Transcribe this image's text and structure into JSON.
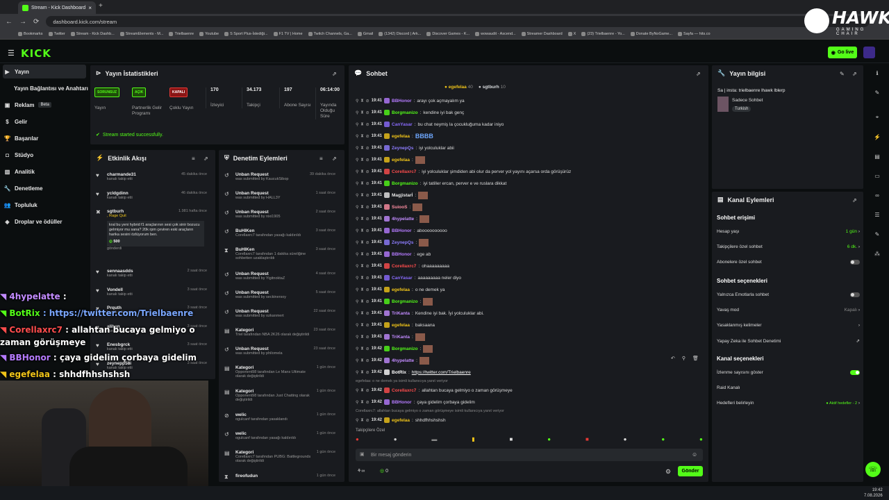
{
  "browser": {
    "tab_title": "Stream - Kick Dashboard",
    "url": "dashboard.kick.com/stream",
    "bookmarks": [
      "Bookmarks",
      "Twitter",
      "Stream - Kick Dashb...",
      "StreamElements - M...",
      "Trielbaenre",
      "Youtube",
      "S Sport Plus-İstediği...",
      "F1 TV | Home",
      "Twitch Channels, Ga...",
      "Gmail",
      "(1342) Discord | Ark...",
      "Discover Games - K...",
      "wowaudit - Ascend...",
      "Streamer Dashboard",
      "X",
      "(23) Trielbaenre - Yo...",
      "Donate ByNoGame...",
      "Sayfa — hits.co"
    ]
  },
  "brand": {
    "logo": "KICK",
    "go_live": "Go live",
    "hawk": "HAWK",
    "hawk_sub": "GAMING CHAIR"
  },
  "sidebar": [
    {
      "label": "Yayın",
      "icon": "video-icon"
    },
    {
      "label": "Yayın Bağlantısı ve Anahtarı",
      "icon": ""
    },
    {
      "label": "Reklam",
      "icon": "ad-icon",
      "badge": "Beta"
    },
    {
      "label": "Gelir",
      "icon": "money-icon"
    },
    {
      "label": "Başarılar",
      "icon": "trophy-icon"
    },
    {
      "label": "Stüdyo",
      "icon": "studio-icon"
    },
    {
      "label": "Analitik",
      "icon": "chart-icon"
    },
    {
      "label": "Denetleme",
      "icon": "wrench-icon"
    },
    {
      "label": "Topluluk",
      "icon": "community-icon"
    },
    {
      "label": "Droplar ve ödüller",
      "icon": "drop-icon"
    }
  ],
  "stats": {
    "title": "Yayın İstatistikleri",
    "items": [
      {
        "badge": "SORUNSUZ",
        "badge_color": "#53fc18",
        "label": "Yayın"
      },
      {
        "badge": "AÇIK",
        "badge_color": "#53fc18",
        "label": "Partnerlik Gelir Programı"
      },
      {
        "badge": "KAPALI",
        "badge_color": "#e53935",
        "label": "Çoklu Yayın"
      },
      {
        "value": "170",
        "label": "İzleyici"
      },
      {
        "value": "34.173",
        "label": "Takipçi"
      },
      {
        "value": "197",
        "label": "Abone Sayısı"
      },
      {
        "value": "06:14:00",
        "label": "Yayında Olduğu Süre"
      }
    ],
    "success": "Stream started successfully."
  },
  "activity": {
    "title": "Etkinlik Akışı",
    "items": [
      {
        "name": "charmande31",
        "desc": "kanalı takip etti",
        "time": "45 dakika önce",
        "icon": "heart-icon"
      },
      {
        "name": "ycldgdinn",
        "desc": "kanalı takip etti",
        "time": "46 dakika önce",
        "icon": "heart-icon"
      },
      {
        "name": "sgtburh",
        "desc": ", Rage Quit",
        "time": "1.981 hafta önce",
        "icon": "x-icon",
        "note": "kral bu yeni hybrid f1 araçlarının sesi çok sinir bozucu gelmiyor mu sana? 20k rpm çeviren eski araçların harika sesini özlüyorum ben.",
        "amount": "500",
        "sent": "gönderdi"
      },
      {
        "name": "sennaasdds",
        "desc": "kanalı takip etti",
        "time": "2 saat önce",
        "icon": "heart-icon"
      },
      {
        "name": "Vondell",
        "desc": "kanalı takip etti",
        "time": "3 saat önce",
        "icon": "heart-icon"
      },
      {
        "name": "Prquth",
        "desc": "kanalı takip etti",
        "time": "3 saat önce",
        "icon": "heart-icon"
      },
      {
        "name": "alihan",
        "desc": "kanalı takip etti",
        "time": "3 saat önce",
        "icon": "heart-icon"
      },
      {
        "name": "Enesbgrck",
        "desc": "kanalı takip etti",
        "time": "3 saat önce",
        "icon": "heart-icon"
      },
      {
        "name": "zeynepp58i",
        "desc": "kanalı takip etti",
        "time": "3 saat önce",
        "icon": "heart-icon"
      }
    ]
  },
  "moderation": {
    "title": "Denetim Eylemleri",
    "items": [
      {
        "title": "Unban Request",
        "desc": "was submitted by KaucukSibop",
        "time": "39 dakika önce",
        "icon": "undo-icon"
      },
      {
        "title": "Unban Request",
        "desc": "was submitted by HALL3Y",
        "time": "1 saat önce",
        "icon": "undo-icon"
      },
      {
        "title": "Unban Request",
        "desc": "was submitted by nixi1905",
        "time": "2 saat önce",
        "icon": "undo-icon"
      },
      {
        "title": "BuHIKen",
        "desc": "Corellaxrc7 tarafından yasağı kaldırıldı",
        "time": "3 saat önce",
        "icon": "undo-icon"
      },
      {
        "title": "BuHIKen",
        "desc": "Corellaxrc7 tarafından 1 dakika süreliğine sohbetten uzaklaştırıldı",
        "time": "3 saat önce",
        "icon": "hourglass-icon"
      },
      {
        "title": "Unban Request",
        "desc": "was submitted by YigitnoktaZ",
        "time": "4 saat önce",
        "icon": "undo-icon"
      },
      {
        "title": "Unban Request",
        "desc": "was submitted by seckinersoy",
        "time": "5 saat önce",
        "icon": "undo-icon"
      },
      {
        "title": "Unban Request",
        "desc": "was submitted by ozkanmert",
        "time": "22 saat önce",
        "icon": "undo-icon"
      },
      {
        "title": "Kategori",
        "desc": "Triel tarafından NBA 2K26 olarak değiştirildi",
        "time": "23 saat önce",
        "icon": "category-icon"
      },
      {
        "title": "Unban Request",
        "desc": "was submitted by philomela",
        "time": "23 saat önce",
        "icon": "undo-icon"
      },
      {
        "title": "Kategori",
        "desc": "Opponent98 tarafından Le Mans Ultimate olarak değiştirildi",
        "time": "1 gün önce",
        "icon": "category-icon"
      },
      {
        "title": "Kategori",
        "desc": "Opponent98 tarafından Just Chatting olarak değiştirildi",
        "time": "1 gün önce",
        "icon": "category-icon"
      },
      {
        "title": "welic",
        "desc": "ogulcanf tarafından yasaklandı",
        "time": "1 gün önce",
        "icon": "ban-icon"
      },
      {
        "title": "welic",
        "desc": "ogulcanf tarafından yasağı kaldırıldı",
        "time": "1 gün önce",
        "icon": "undo-icon"
      },
      {
        "title": "Kategori",
        "desc": "Corellaxrc7 tarafından PUBG: Battlegrounds olarak değiştirildi",
        "time": "1 gün önce",
        "icon": "category-icon"
      },
      {
        "title": "fireofudun",
        "desc": "",
        "time": "1 gün önce",
        "icon": "hourglass-icon"
      }
    ]
  },
  "chat": {
    "title": "Sohbet",
    "pinned": [
      {
        "name": "egefelaa",
        "count": "40"
      },
      {
        "name": "sgtburh",
        "count": "10"
      }
    ],
    "messages": [
      {
        "time": "19:41",
        "user": "BBHonor",
        "color": "#b57bff",
        "text": "arayı çok açmayalım ya"
      },
      {
        "time": "19:41",
        "user": "Borgmanizo",
        "color": "#53fc18",
        "text": "kendine iyi bak genç"
      },
      {
        "time": "19:41",
        "user": "CanYasar",
        "color": "#8b6cff",
        "text": "bu chat neymiş la çocukluğuma kadar iniyo"
      },
      {
        "time": "19:41",
        "user": "egefelaa",
        "color": "#f0c419",
        "text": "BBBB"
      },
      {
        "time": "19:41",
        "user": "ZeynepQs",
        "color": "#8e7dff",
        "text": "iyi yolculuklar abii"
      },
      {
        "time": "19:41",
        "user": "egefelaa",
        "color": "#f0c419",
        "text": "[emote]"
      },
      {
        "time": "19:41",
        "user": "Corellaxrc7",
        "color": "#ff4d4d",
        "text": "iyi yolculuklar şimdiden abi olur da perver yol yayını açarsa orda görüşürüz"
      },
      {
        "time": "19:41",
        "user": "Borgmanizo",
        "color": "#53fc18",
        "text": "iyi tatiller ercan, perver e ve ruslara dikkat"
      },
      {
        "time": "19:41",
        "user": "Magjistarİ",
        "color": "#e8e8e8",
        "text": "[emote]"
      },
      {
        "time": "19:41",
        "user": "SuiooS",
        "color": "#ff8fa3",
        "text": "[emote]"
      },
      {
        "time": "19:41",
        "user": "4hypelatte",
        "color": "#c28bff",
        "text": "[emote]"
      },
      {
        "time": "19:41",
        "user": "BBHonor",
        "color": "#b57bff",
        "text": "aboooooooooo"
      },
      {
        "time": "19:41",
        "user": "ZeynepQs",
        "color": "#8e7dff",
        "text": "[emote]"
      },
      {
        "time": "19:41",
        "user": "BBHonor",
        "color": "#b57bff",
        "text": "ege ab"
      },
      {
        "time": "19:41",
        "user": "Corellaxrc7",
        "color": "#ff4d4d",
        "text": "ohaaaaaaaaa"
      },
      {
        "time": "19:41",
        "user": "CanYasar",
        "color": "#8b6cff",
        "text": "aaaaaaaaa neler diyo"
      },
      {
        "time": "19:41",
        "user": "egefelaa",
        "color": "#f0c419",
        "text": "o ne demek ya"
      },
      {
        "time": "19:41",
        "user": "Borgmanizo",
        "color": "#53fc18",
        "text": "[emote]"
      },
      {
        "time": "19:41",
        "user": "TriKanta",
        "color": "#c28bff",
        "text": "Kendine iyi bak. İyi yolculuklar abi."
      },
      {
        "time": "19:41",
        "user": "egefelaa",
        "color": "#f0c419",
        "text": "baksaana"
      },
      {
        "time": "19:41",
        "user": "TriKanta",
        "color": "#c28bff",
        "text": "[emote]"
      },
      {
        "time": "19:42",
        "user": "Borgmanizo",
        "color": "#53fc18",
        "text": "[emote]"
      },
      {
        "time": "19:42",
        "user": "4hypelatte",
        "color": "#c28bff",
        "text": "[emote]"
      },
      {
        "time": "19:42",
        "user": "BotRix",
        "color": "#ffffff",
        "text": "https://twitter.com/Trielbaenre"
      },
      {
        "reply": "egefelaa: o ne demek ya isimli kullanıcıya yanıt veriyor",
        "time": "19:42",
        "user": "Corellaxrc7",
        "color": "#ff4d4d",
        "text": "allahtan bucaya gelmiyo o zaman görüşmeye"
      },
      {
        "time": "19:42",
        "user": "BBHonor",
        "color": "#b57bff",
        "text": "çaya gidelim çorbaya gidelim"
      },
      {
        "reply": "Corellaxrc7: allahtan bucaya gelmiyo o zaman görüşmeye isimli kullanıcıya yanıt veriyor",
        "time": "19:42",
        "user": "egefelaa",
        "color": "#f0c419",
        "text": "shhdfhhshshsh"
      }
    ],
    "followers_only": "Takipçilere Özel",
    "placeholder": "Bir mesaj gönderin",
    "send": "Gönder",
    "points": "0"
  },
  "info": {
    "title": "Yayın bilgisi",
    "stream_title": "Sa | insta: trielbaenre lhawk lblerp",
    "category": "Sadece Sohbet",
    "tag": "Turkish"
  },
  "channel": {
    "title": "Kanal Eylemleri",
    "sec1": "Sohbet erişimi",
    "hesap": "Hesap yaşı",
    "hesap_val": "1 gün",
    "takipci": "Takipçilere özel sohbet",
    "takipci_val": "6 dk.",
    "abone": "Abonelere özel sohbet",
    "sec2": "Sohbet seçenekleri",
    "emote": "Yalnızca Emotlarla sohbet",
    "yavas": "Yavaş mod",
    "yavas_val": "Kapalı",
    "yasak": "Yasaklanmış kelimeler",
    "yapay": "Yapay Zeka ile Sohbet Denetimi",
    "sec3": "Kanal seçenekleri",
    "izlenme": "İzlenme sayısını göster",
    "raid": "Raid Kanalı",
    "hedef": "Hedefleri belirleyin",
    "hedef_val": "● Aktif hedefler - 2"
  },
  "overlay": [
    {
      "user": "4hypelatte",
      "text": " : ",
      "color": "#c28bff"
    },
    {
      "user": "BotRix",
      "text": " : https://twitter.com/Trielbaenre",
      "color": "#53fc18"
    },
    {
      "user": "Corellaxrc7",
      "text": " : allahtan bucaya gelmiyo o",
      "color": "#ff4d4d"
    },
    {
      "user": "",
      "text": "zaman görüşmeye",
      "color": "#fff"
    },
    {
      "user": "BBHonor",
      "text": " : çaya gidelim çorbaya gidelim",
      "color": "#b57bff"
    },
    {
      "user": "egefelaa",
      "text": " : shhdfhhshshsh",
      "color": "#f0c419"
    }
  ],
  "clock": {
    "time": "19:42",
    "date": "7.08.2026"
  }
}
